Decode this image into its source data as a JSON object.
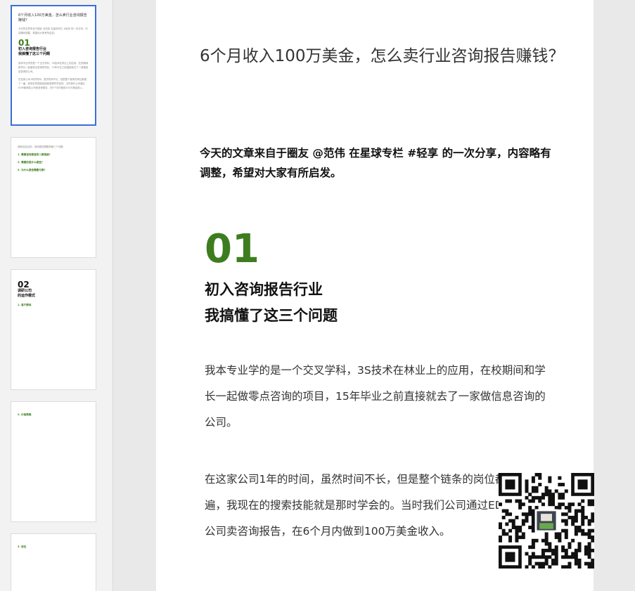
{
  "thumbnails": [
    {
      "title": "6个月收入100万美金，怎么卖行业咨询报告赚钱？",
      "intro": "今天的文章来自于圈友 @范伟 在星球专栏 #轻享 的一次分享，内容略有调整，希望对大家有所启发。",
      "num": "01",
      "heading1": "初入咨询报告行业",
      "heading2": "我搞懂了这三个问题",
      "p1": "我本专业学的是一个交叉学科，3S技术在林业上的应用，在校期间和学长一起做零点咨询的项目，15年毕业之前直接就去了一家做信息咨询的公司。",
      "p2": "在这家公司1年的时间，虽然时间不长，但是整个链条的岗位都做了一遍，我现在的搜索技能就是那时学会的。当时我们公司通过EDM营销给公司卖咨询报告，在6个月内做到100万美金收入。"
    },
    {
      "l1": "我就总结出的，咨询报告需要搞懂三个问题：",
      "g1": "1. 需要咨询报告的人群是谁？",
      "l2": "",
      "l3": "",
      "g2": "2. 需要的是什么报告？",
      "l4": "",
      "l5": "",
      "g3": "3. 为什么报告需要付费？"
    },
    {
      "l1": "",
      "num": "02",
      "h1": "调研公司",
      "h2": "的运作模式",
      "l2": "",
      "g1": "1. 客户群体",
      "l3": ""
    },
    {
      "l1": "",
      "g1": "2. 价格策略",
      "l2": "",
      "l3": "",
      "l4": ""
    },
    {
      "l1": "",
      "g1": "3. 定位",
      "l2": "",
      "b1": ""
    }
  ],
  "document": {
    "title": "6个月收入100万美金，怎么卖行业咨询报告赚钱？",
    "intro": "今天的文章来自于圈友 @范伟 在星球专栏 #轻享 的一次分享，内容略有调整，希望对大家有所启发。",
    "section_number": "01",
    "section_title_line1": "初入咨询报告行业",
    "section_title_line2": "我搞懂了这三个问题",
    "paragraph1": "我本专业学的是一个交叉学科，3S技术在林业上的应用，在校期间和学长一起做零点咨询的项目，15年毕业之前直接就去了一家做信息咨询的公司。",
    "paragraph2": "在这家公司1年的时间，虽然时间不长，但是整个链条的岗位都做了一遍，我现在的搜索技能就是那时学会的。当时我们公司通过EDM营销给公司卖咨询报告，在6个月内做到100万美金收入。"
  },
  "colors": {
    "accent_green": "#3e7d1f",
    "selected_border": "#3a6fd8"
  },
  "qr_icon": "qr-code-icon"
}
